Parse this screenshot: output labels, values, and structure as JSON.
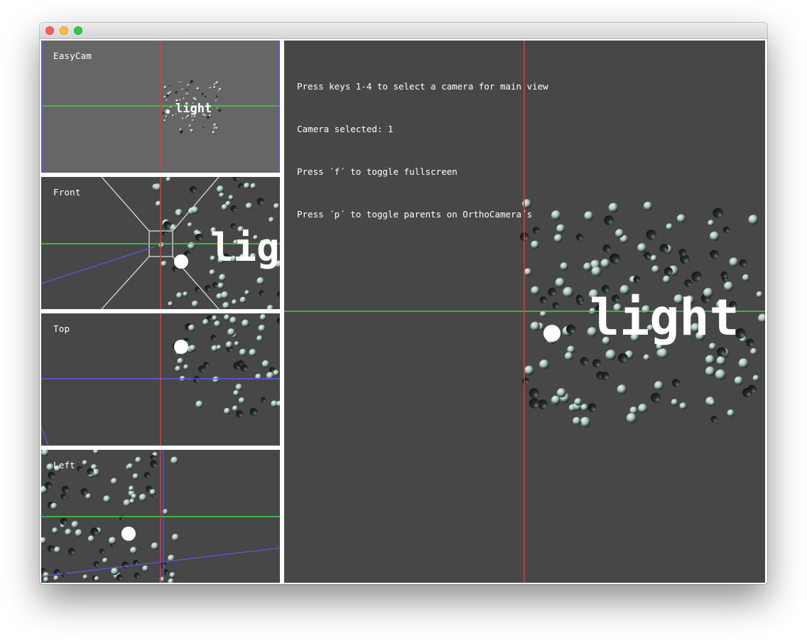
{
  "window": {
    "controls": [
      "close",
      "minimize",
      "maximize"
    ]
  },
  "views": {
    "easycam": {
      "label": "EasyCam"
    },
    "front": {
      "label": "Front"
    },
    "top": {
      "label": "Top"
    },
    "left": {
      "label": "Left"
    }
  },
  "main_view": {
    "instructions": [
      "Press keys 1-4 to select a camera for main view",
      "Camera selected: 1",
      "Press ´f´ to toggle fullscreen",
      "Press ´p´ to toggle parents on OrthoCamera´s"
    ]
  },
  "scene": {
    "light_label": "light"
  },
  "colors": {
    "background_dark": "#474747",
    "background_easycam": "#666666",
    "axis_x": "#3ad93a",
    "axis_y": "#e03a3a",
    "axis_z": "#5a5ae6",
    "sphere": "#a9c4bc",
    "light": "#ffffff"
  }
}
